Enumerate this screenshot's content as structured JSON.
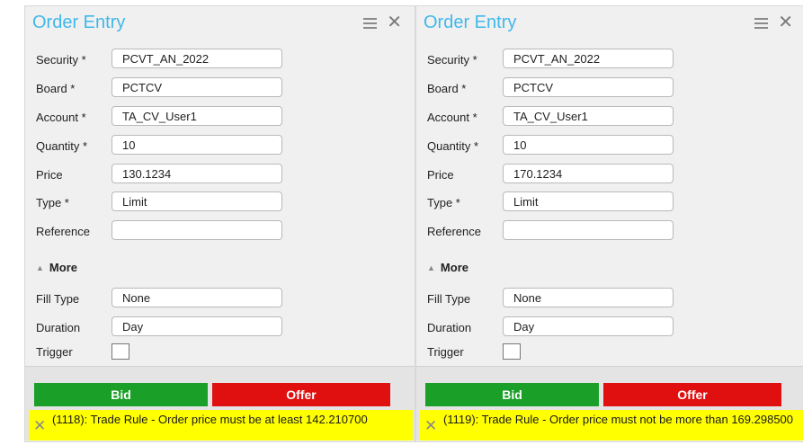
{
  "panels": [
    {
      "title": "Order Entry",
      "fields": [
        {
          "label": "Security *",
          "value": "PCVT_AN_2022"
        },
        {
          "label": "Board *",
          "value": "PCTCV"
        },
        {
          "label": "Account *",
          "value": "TA_CV_User1"
        },
        {
          "label": "Quantity *",
          "value": "10"
        },
        {
          "label": "Price",
          "value": "130.1234"
        },
        {
          "label": "Type *",
          "value": "Limit"
        },
        {
          "label": "Reference",
          "value": ""
        }
      ],
      "more_label": "More",
      "more_fields": [
        {
          "label": "Fill Type",
          "value": "None"
        },
        {
          "label": "Duration",
          "value": "Day"
        }
      ],
      "trigger_label": "Trigger",
      "trigger_checked": false,
      "bid_label": "Bid",
      "offer_label": "Offer",
      "message": "(1118): Trade Rule - Order price must be at least 142.210700"
    },
    {
      "title": "Order Entry",
      "fields": [
        {
          "label": "Security *",
          "value": "PCVT_AN_2022"
        },
        {
          "label": "Board *",
          "value": "PCTCV"
        },
        {
          "label": "Account *",
          "value": "TA_CV_User1"
        },
        {
          "label": "Quantity *",
          "value": "10"
        },
        {
          "label": "Price",
          "value": "170.1234"
        },
        {
          "label": "Type *",
          "value": "Limit"
        },
        {
          "label": "Reference",
          "value": ""
        }
      ],
      "more_label": "More",
      "more_fields": [
        {
          "label": "Fill Type",
          "value": "None"
        },
        {
          "label": "Duration",
          "value": "Day"
        }
      ],
      "trigger_label": "Trigger",
      "trigger_checked": false,
      "bid_label": "Bid",
      "offer_label": "Offer",
      "message": "(1119): Trade Rule - Order price must not be more than 169.298500"
    }
  ],
  "colors": {
    "title": "#41b8ea",
    "bid": "#1aa028",
    "offer": "#e01010",
    "message_bg": "#ffff00"
  }
}
